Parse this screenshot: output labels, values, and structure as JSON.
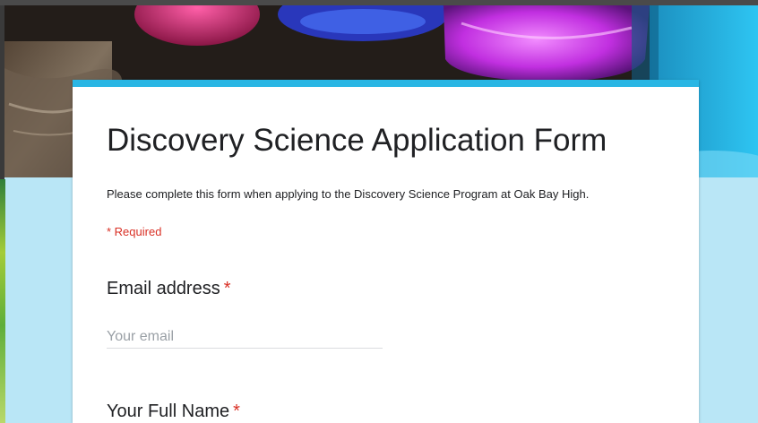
{
  "form": {
    "title": "Discovery Science Application Form",
    "description": "Please complete this form when applying to the Discovery Science Program at Oak Bay High.",
    "required_note": "* Required"
  },
  "questions": [
    {
      "label": "Email address",
      "required_mark": "*",
      "placeholder": "Your email"
    },
    {
      "label": "Your Full Name",
      "required_mark": "*"
    }
  ],
  "colors": {
    "accent": "#29b6e4",
    "page_background": "#b9e6f6",
    "required": "#d93025"
  }
}
